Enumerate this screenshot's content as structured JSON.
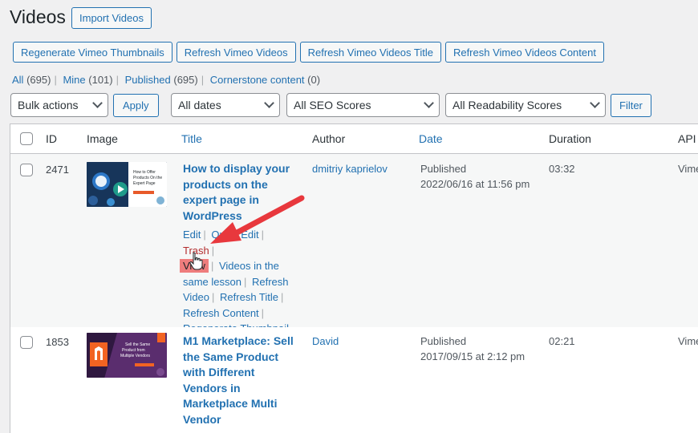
{
  "page": {
    "title": "Videos",
    "import_label": "Import Videos"
  },
  "actions": {
    "regenerate": "Regenerate Vimeo Thumbnails",
    "refresh": "Refresh Vimeo Videos",
    "refresh_title": "Refresh Vimeo Videos Title",
    "refresh_content": "Refresh Vimeo Videos Content"
  },
  "views": [
    {
      "label": "All",
      "count": "(695)"
    },
    {
      "label": "Mine",
      "count": "(101)"
    },
    {
      "label": "Published",
      "count": "(695)"
    },
    {
      "label": "Cornerstone content",
      "count": "(0)"
    }
  ],
  "filters": {
    "bulk": "Bulk actions",
    "apply": "Apply",
    "dates": "All dates",
    "seo": "All SEO Scores",
    "readability": "All Readability Scores",
    "filter": "Filter"
  },
  "columns": {
    "id": "ID",
    "image": "Image",
    "title": "Title",
    "author": "Author",
    "date": "Date",
    "duration": "Duration",
    "api": "API"
  },
  "rows": [
    {
      "id": "2471",
      "title": "How to display your products on the expert page in WordPress",
      "author": "dmitriy kaprielov",
      "status": "Published",
      "date": "2022/06/16 at 11:56 pm",
      "duration": "03:32",
      "api": "Vime",
      "thumb_text": "How to Offer Products On the Expert Page",
      "actions": {
        "edit": "Edit",
        "quick_edit": "Quick Edit",
        "trash": "Trash",
        "view": "View",
        "lesson": "Videos in the same lesson",
        "refresh_video": "Refresh Video",
        "refresh_title": "Refresh Title",
        "refresh_content": "Refresh Content",
        "regenerate": "Regenerate Thumbnail"
      }
    },
    {
      "id": "1853",
      "title": "M1 Marketplace: Sell the Same Product with Different Vendors in Marketplace Multi Vendor",
      "author": "David",
      "status": "Published",
      "date": "2017/09/15 at 2:12 pm",
      "duration": "02:21",
      "api": "Vime",
      "thumb_text": "Sell the Same Product from Multiple Vendors"
    }
  ],
  "colors": {
    "accent": "#2271b1",
    "trash": "#b32d2e",
    "highlight": "#ee7d7d",
    "arrow": "#e8383d"
  }
}
